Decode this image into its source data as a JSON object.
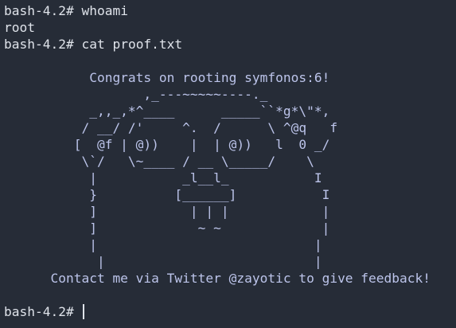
{
  "colors": {
    "background": "#262c37",
    "foreground": "#dfe3ea",
    "art_text": "#bcc4ea"
  },
  "terminal": {
    "prompt": "bash-4.2# ",
    "commands": [
      {
        "command": "whoami",
        "output": "root"
      },
      {
        "command": "cat proof.txt"
      }
    ],
    "proof_lines": [
      "",
      "           Congrats on rooting symfonos:6!",
      "                  ,_---~~~~~----._",
      "           _,,_,*^____      _____``*g*\\\"*,",
      "          / __/ /'     ^.  /      \\ ^@q   f",
      "         [  @f | @))    |  | @))   l  0 _/",
      "          \\`/   \\~____ / __ \\_____/    \\",
      "           |           _l__l_           I",
      "           }          [______]           I",
      "           ]            | | |            |",
      "           ]             ~ ~             |",
      "           |                            |",
      "            |                           |",
      "      Contact me via Twitter @zayotic to give feedback!",
      ""
    ],
    "final_prompt": "bash-4.2# "
  }
}
